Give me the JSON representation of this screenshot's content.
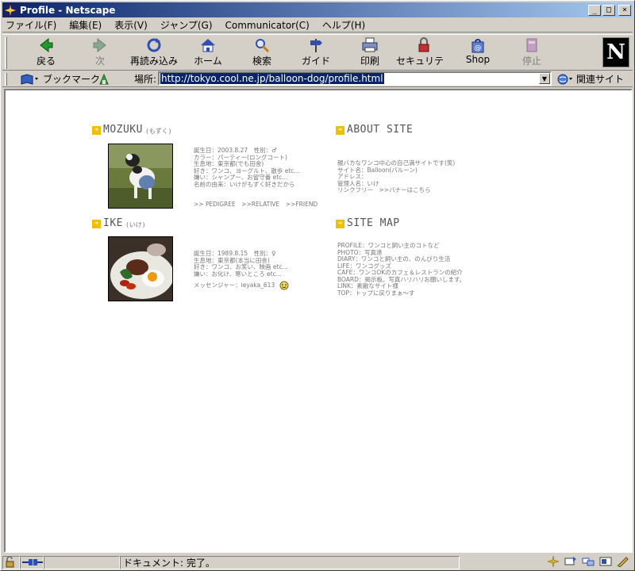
{
  "window": {
    "title": "Profile - Netscape",
    "minimize": "_",
    "maximize": "□",
    "close": "×"
  },
  "menu": [
    "ファイル(F)",
    "編集(E)",
    "表示(V)",
    "ジャンプ(G)",
    "Communicator(C)",
    "ヘルプ(H)"
  ],
  "toolbar": {
    "back": "戻る",
    "forward": "次",
    "reload": "再読み込み",
    "home": "ホーム",
    "search": "検索",
    "guide": "ガイド",
    "print": "印刷",
    "security": "セキュリティ",
    "shop": "Shop",
    "stop": "停止",
    "logo": "N"
  },
  "location": {
    "bookmarks": "ブックマーク",
    "label": "場所:",
    "url": "http://tokyo.cool.ne.jp/balloon-dog/profile.html",
    "related": "関連サイト"
  },
  "page": {
    "mozuku": {
      "title": "MOZUKU",
      "sub": "(もずく)",
      "lines": [
        "誕生日：2003.8.27　性別：♂",
        "カラー：パーティー(ロングコート)",
        "生息地：東京都(でも田舎)",
        "好き：ワンコ、ヨーグルト、散歩 etc...",
        "嫌い：シャンプー、お留守番 etc...",
        "名前の由来：いけがもずく好きだから"
      ],
      "links": ">> PEDIGREE　>>RELATIVE　>>FRIEND"
    },
    "ike": {
      "title": "IKE",
      "sub": "(いけ)",
      "lines": [
        "誕生日：1989.8.15　性別：♀",
        "生息地：東京都(本当に田舎)",
        "好き：ワンコ、お笑い、映画 etc...",
        "嫌い：お化け、寒いところ etc..."
      ],
      "messenger": "メッセンジャー：ieyaka_613"
    },
    "about": {
      "title": "ABOUT SITE",
      "lines": [
        "親バカなワンコ中心の自己満サイトです(笑)",
        "サイト名：Balloon(バルーン)",
        "アドレス：",
        "管理人名：いけ",
        "リンクフリー　>>バナーはこちら"
      ]
    },
    "sitemap": {
      "title": "SITE MAP",
      "lines": [
        "PROFILE：ワンコと飼い主のコトなど",
        "PHOTO：写真達",
        "DIARY：ワンコと飼い主の、のんびり生活",
        "LIFE：ワンコグッズ",
        "CAFE：ワンコOKのカフェ＆レストランの紹介",
        "BOARD：掲示板。写真ハリハリお願いします。",
        "LINK：素敵なサイト様",
        "TOP：トップに戻りまぁ～す"
      ]
    }
  },
  "status": {
    "text": "ドキュメント: 完了。"
  }
}
